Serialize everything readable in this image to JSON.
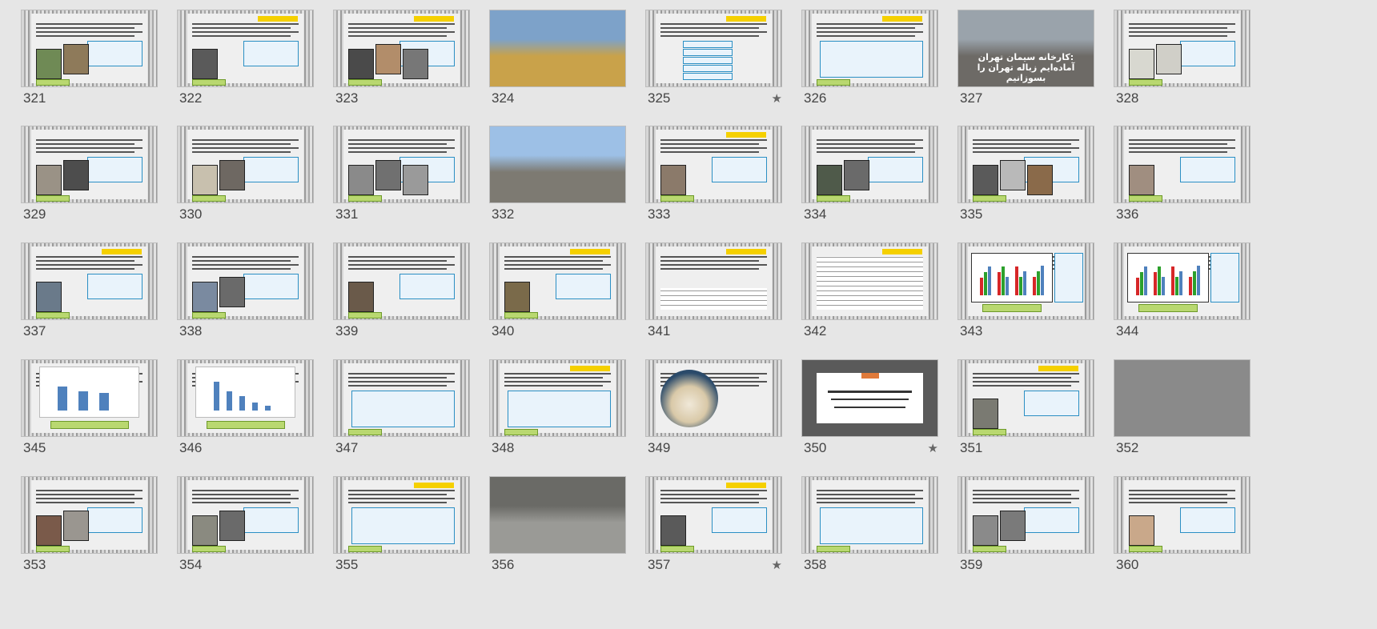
{
  "slides": [
    {
      "n": "321",
      "style": "text",
      "photos": [
        "#6f8a55",
        "#8e7a5a"
      ],
      "yellow": false
    },
    {
      "n": "322",
      "style": "text",
      "photos": [
        "#5a5a5a"
      ],
      "yellow": true
    },
    {
      "n": "323",
      "style": "text",
      "photos": [
        "#4a4a4a",
        "#b28d6a",
        "#777"
      ],
      "yellow": true
    },
    {
      "n": "324",
      "style": "photo",
      "bg": "#c9a24a",
      "sky": "#7da2c9"
    },
    {
      "n": "325",
      "style": "list",
      "photos": [],
      "yellow": true,
      "star": true
    },
    {
      "n": "326",
      "style": "text",
      "photos": [],
      "yellow": true
    },
    {
      "n": "327",
      "style": "photo",
      "bg": "#6d6a66",
      "sky": "#9aa3ab",
      "caption": "کارخانه سیمان تهران:\nآماده‌ایم زباله تهران را بسوزانیم"
    },
    {
      "n": "328",
      "style": "text",
      "photos": [
        "#d8d8d0",
        "#d0cfc8"
      ],
      "yellow": false
    },
    {
      "n": "329",
      "style": "text",
      "photos": [
        "#9a9286",
        "#4d4d4d"
      ],
      "yellow": false
    },
    {
      "n": "330",
      "style": "text",
      "photos": [
        "#c8c0ae",
        "#6e6862"
      ],
      "yellow": false
    },
    {
      "n": "331",
      "style": "text",
      "photos": [
        "#8a8a8a",
        "#707070",
        "#9a9a9a"
      ],
      "yellow": false
    },
    {
      "n": "332",
      "style": "photo",
      "bg": "#7d7a72",
      "sky": "#9dc0e6"
    },
    {
      "n": "333",
      "style": "text",
      "photos": [
        "#8b7a6a"
      ],
      "yellow": true
    },
    {
      "n": "334",
      "style": "text",
      "photos": [
        "#4f5a4a",
        "#6a6a6a"
      ],
      "yellow": false
    },
    {
      "n": "335",
      "style": "text",
      "photos": [
        "#5a5a5a",
        "#b9b9b9",
        "#8a6a4a"
      ],
      "yellow": false
    },
    {
      "n": "336",
      "style": "text",
      "photos": [
        "#a08e80"
      ],
      "yellow": false
    },
    {
      "n": "337",
      "style": "text",
      "photos": [
        "#6a7a8a"
      ],
      "yellow": true
    },
    {
      "n": "338",
      "style": "text",
      "photos": [
        "#7a8aa0",
        "#6a6a6a"
      ],
      "yellow": false
    },
    {
      "n": "339",
      "style": "text",
      "photos": [
        "#6a5a4a"
      ],
      "yellow": false
    },
    {
      "n": "340",
      "style": "text",
      "photos": [
        "#7a6a4a"
      ],
      "yellow": true
    },
    {
      "n": "341",
      "style": "table",
      "photos": [],
      "yellow": true
    },
    {
      "n": "342",
      "style": "bigtable",
      "photos": [],
      "yellow": true
    },
    {
      "n": "343",
      "style": "chart",
      "photos": [],
      "yellow": false
    },
    {
      "n": "344",
      "style": "chart",
      "photos": [],
      "yellow": false
    },
    {
      "n": "345",
      "style": "bars",
      "photos": [],
      "yellow": false
    },
    {
      "n": "346",
      "style": "bars2",
      "photos": [],
      "yellow": false
    },
    {
      "n": "347",
      "style": "text",
      "photos": [],
      "yellow": false
    },
    {
      "n": "348",
      "style": "text",
      "photos": [],
      "yellow": true
    },
    {
      "n": "349",
      "style": "circle",
      "photos": [],
      "yellow": false
    },
    {
      "n": "350",
      "style": "title",
      "photos": [],
      "yellow": false,
      "star": true
    },
    {
      "n": "351",
      "style": "text",
      "photos": [
        "#7a7a72"
      ],
      "yellow": true
    },
    {
      "n": "352",
      "style": "photo",
      "bg": "#8a8a8a",
      "sky": "#8a8a8a"
    },
    {
      "n": "353",
      "style": "text",
      "photos": [
        "#7a5a4a",
        "#9a9690"
      ],
      "yellow": false
    },
    {
      "n": "354",
      "style": "text",
      "photos": [
        "#8a8a80",
        "#6a6a6a"
      ],
      "yellow": false
    },
    {
      "n": "355",
      "style": "text",
      "photos": [],
      "yellow": true
    },
    {
      "n": "356",
      "style": "photo",
      "bg": "#9a9a96",
      "sky": "#6a6a66"
    },
    {
      "n": "357",
      "style": "text",
      "photos": [
        "#5a5a5a"
      ],
      "yellow": true,
      "star": true
    },
    {
      "n": "358",
      "style": "text",
      "photos": [],
      "yellow": false
    },
    {
      "n": "359",
      "style": "text",
      "photos": [
        "#8a8a8a",
        "#7a7a7a"
      ],
      "yellow": false
    },
    {
      "n": "360",
      "style": "text",
      "photos": [
        "#c9a88a"
      ],
      "yellow": false
    }
  ],
  "icons": {
    "favorite": "star-icon"
  },
  "star_glyph": "★"
}
